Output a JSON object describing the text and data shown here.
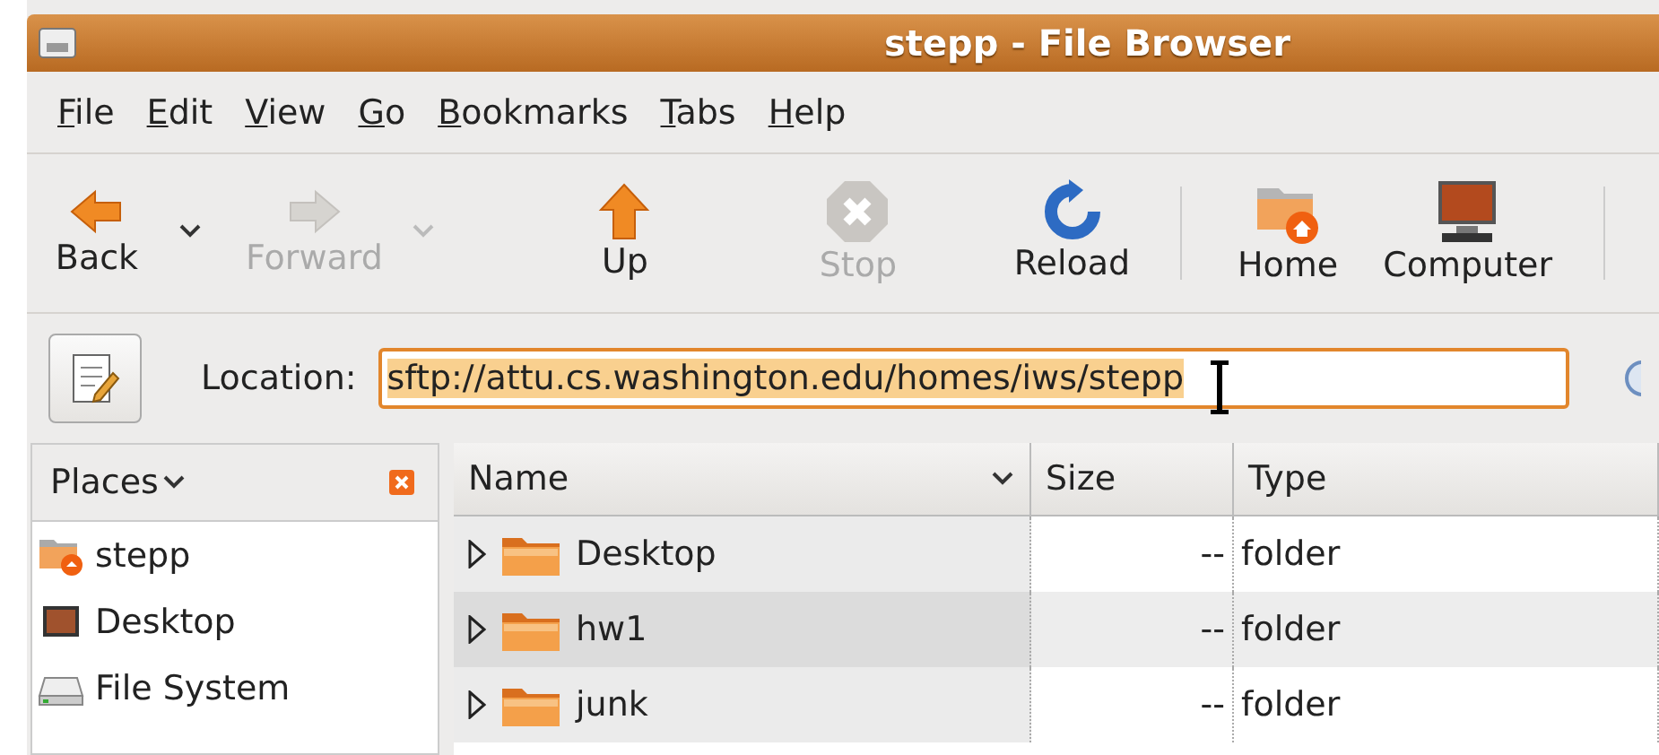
{
  "window": {
    "title": "stepp - File Browser"
  },
  "menu": [
    {
      "label": "File"
    },
    {
      "label": "Edit"
    },
    {
      "label": "View"
    },
    {
      "label": "Go"
    },
    {
      "label": "Bookmarks"
    },
    {
      "label": "Tabs"
    },
    {
      "label": "Help"
    }
  ],
  "toolbar": [
    {
      "kind": "button",
      "label": "Back",
      "disabled": false,
      "has_menu": true
    },
    {
      "kind": "button",
      "label": "Forward",
      "disabled": true,
      "has_menu": true
    },
    {
      "kind": "button",
      "label": "Up",
      "disabled": false,
      "has_menu": false
    },
    {
      "kind": "button",
      "label": "Stop",
      "disabled": true,
      "has_menu": false
    },
    {
      "kind": "button",
      "label": "Reload",
      "disabled": false,
      "has_menu": false
    },
    {
      "kind": "separator"
    },
    {
      "kind": "button",
      "label": "Home",
      "disabled": false,
      "has_menu": false
    },
    {
      "kind": "button",
      "label": "Computer",
      "disabled": false,
      "has_menu": false
    },
    {
      "kind": "separator"
    }
  ],
  "location": {
    "label": "Location:",
    "value": "sftp://attu.cs.washington.edu/homes/iws/stepp"
  },
  "sidebar": {
    "title": "Places",
    "items": [
      {
        "label": "stepp"
      },
      {
        "label": "Desktop"
      },
      {
        "label": "File System"
      }
    ]
  },
  "table": {
    "columns": [
      {
        "label": "Name",
        "sorted": true
      },
      {
        "label": "Size",
        "sorted": false
      },
      {
        "label": "Type",
        "sorted": false
      }
    ],
    "rows": [
      {
        "name": "Desktop",
        "size": "--",
        "type": "folder"
      },
      {
        "name": "hw1",
        "size": "--",
        "type": "folder"
      },
      {
        "name": "junk",
        "size": "--",
        "type": "folder"
      }
    ]
  }
}
